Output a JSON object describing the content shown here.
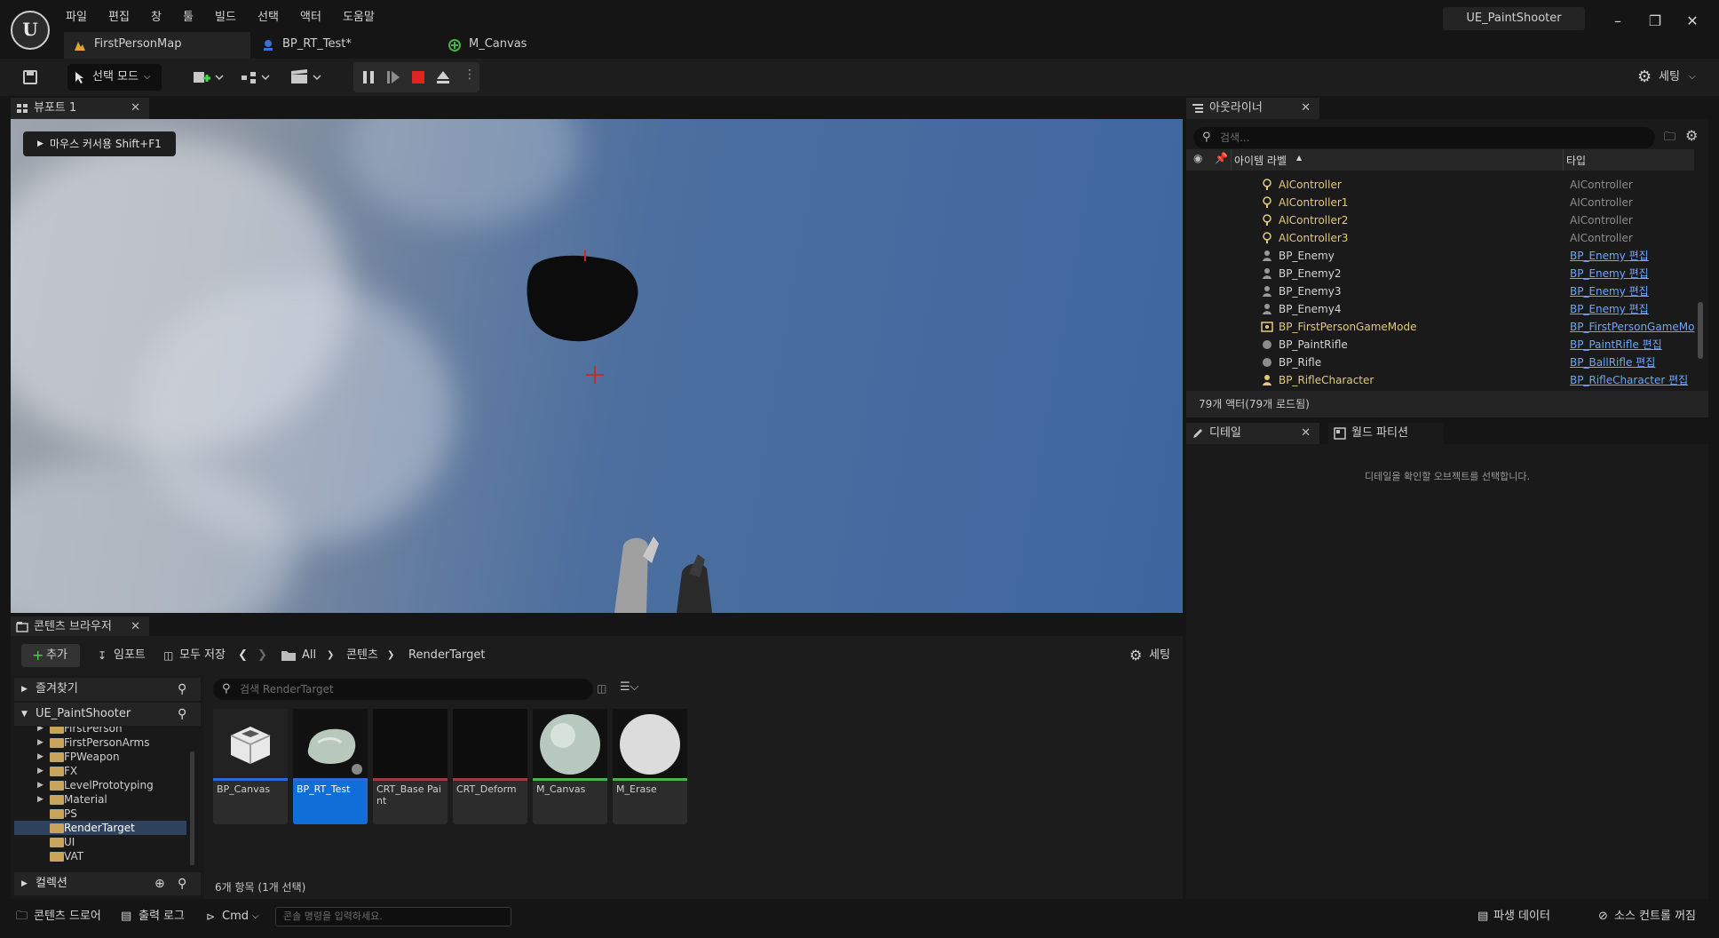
{
  "menu": [
    "파일",
    "편집",
    "창",
    "툴",
    "빌드",
    "선택",
    "액터",
    "도움말"
  ],
  "doc_tabs": [
    "FirstPersonMap",
    "BP_RT_Test*",
    "M_Canvas"
  ],
  "project_name": "UE_PaintShooter",
  "toolbar": {
    "mode_label": "선택 모드",
    "settings_label": "세팅"
  },
  "viewport": {
    "tab_label": "뷰포트 1",
    "cursor_hint": "마우스 커서용 Shift+F1"
  },
  "content_browser": {
    "tab_label": "콘텐츠 브라우저",
    "add_label": "추가",
    "import_label": "임포트",
    "save_all_label": "모두 저장",
    "breadcrumb": [
      "All",
      "콘텐츠",
      "RenderTarget"
    ],
    "settings_label": "세팅",
    "favorites_label": "즐겨찾기",
    "root_label": "UE_PaintShooter",
    "collections_label": "컬렉션",
    "folders": [
      "FirstPerson",
      "FirstPersonArms",
      "FPWeapon",
      "FX",
      "LevelPrototyping",
      "Material",
      "PS",
      "RenderTarget",
      "UI",
      "VAT"
    ],
    "search_placeholder": "검색 RenderTarget",
    "assets": [
      "BP_Canvas",
      "BP_RT_Test",
      "CRT_Base Paint",
      "CRT_Deform",
      "M_Canvas",
      "M_Erase"
    ],
    "item_count": "6개 항목 (1개 선택)"
  },
  "outliner": {
    "tab_label": "아웃라이너",
    "search_placeholder": "검색...",
    "col_label": "아이템 라벨",
    "col_type": "타입",
    "rows": [
      {
        "label": "AIController",
        "type": "AIController"
      },
      {
        "label": "AIController1",
        "type": "AIController"
      },
      {
        "label": "AIController2",
        "type": "AIController"
      },
      {
        "label": "AIController3",
        "type": "AIController"
      },
      {
        "label": "BP_Enemy",
        "type": "BP_Enemy 편집"
      },
      {
        "label": "BP_Enemy2",
        "type": "BP_Enemy 편집"
      },
      {
        "label": "BP_Enemy3",
        "type": "BP_Enemy 편집"
      },
      {
        "label": "BP_Enemy4",
        "type": "BP_Enemy 편집"
      },
      {
        "label": "BP_FirstPersonGameMode",
        "type": "BP_FirstPersonGameMo"
      },
      {
        "label": "BP_PaintRifle",
        "type": "BP_PaintRifle 편집"
      },
      {
        "label": "BP_Rifle",
        "type": "BP_BallRifle 편집"
      },
      {
        "label": "BP_RifleCharacter",
        "type": "BP_RifleCharacter 편집"
      }
    ],
    "actor_count": "79개 액터(79개 로드됨)"
  },
  "details": {
    "tab_label": "디테일",
    "world_partition_label": "월드 파티션",
    "empty_message": "디테일을 확인할 오브젝트를 선택합니다."
  },
  "statusbar": {
    "content_drawer": "콘텐츠 드로어",
    "output_log": "출력 로그",
    "cmd": "Cmd",
    "console_placeholder": "콘솔 명령을 입력하세요.",
    "derived_data": "파생 데이터",
    "source_control": "소스 컨트롤 꺼짐"
  }
}
